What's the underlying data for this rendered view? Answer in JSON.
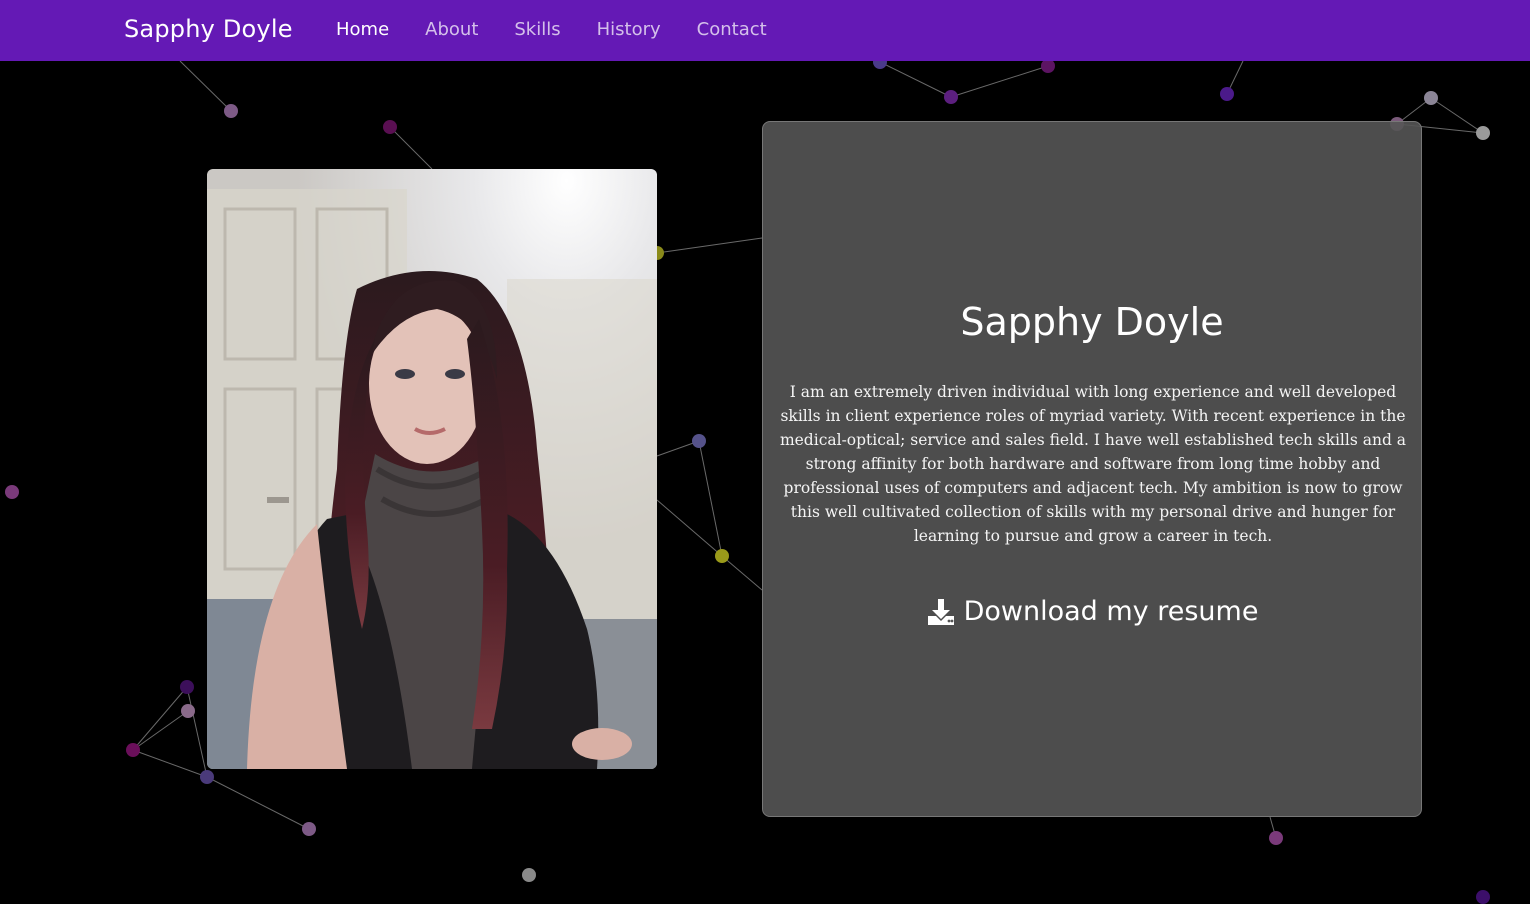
{
  "nav": {
    "brand": "Sapphy Doyle",
    "links": [
      {
        "label": "Home",
        "active": true
      },
      {
        "label": "About",
        "active": false
      },
      {
        "label": "Skills",
        "active": false
      },
      {
        "label": "History",
        "active": false
      },
      {
        "label": "Contact",
        "active": false
      }
    ]
  },
  "profile": {
    "name": "Sapphy Doyle",
    "bio": "I am an extremely driven individual with long experience and well developed skills in client experience roles of myriad variety. With recent experience in the medical-optical; service and sales field. I have well established tech skills and a strong affinity for both hardware and software from long time hobby and professional uses of computers and adjacent tech. My ambition is now to grow this well cultivated collection of skills with my personal drive and hunger for learning to pursue and grow a career in tech.",
    "download_label": "Download my resume",
    "download_icon": "download-icon",
    "photo_icon": "profile-photo"
  },
  "theme": {
    "navbar": "#6419b5",
    "background": "#000000",
    "card": "#555555",
    "particle_colors": [
      "#6a2a8f",
      "#7a5a9e",
      "#4b1a7a",
      "#9a9a9a",
      "#8a8a2a",
      "#3a2a7a"
    ]
  }
}
